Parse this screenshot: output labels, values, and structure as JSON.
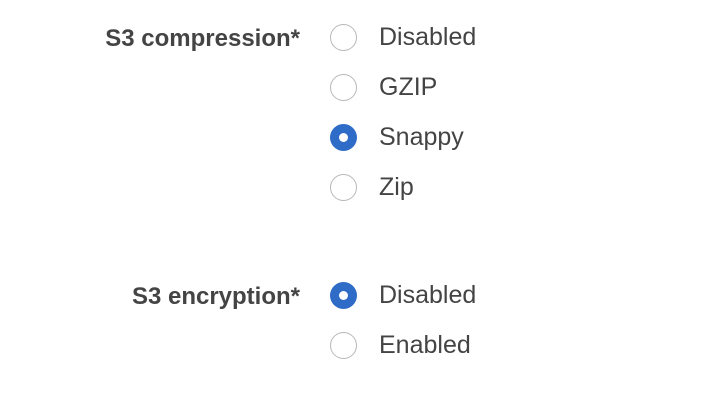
{
  "compression": {
    "label": "S3 compression*",
    "options": [
      {
        "label": "Disabled",
        "selected": false
      },
      {
        "label": "GZIP",
        "selected": false
      },
      {
        "label": "Snappy",
        "selected": true
      },
      {
        "label": "Zip",
        "selected": false
      }
    ]
  },
  "encryption": {
    "label": "S3 encryption*",
    "options": [
      {
        "label": "Disabled",
        "selected": true
      },
      {
        "label": "Enabled",
        "selected": false
      }
    ]
  },
  "colors": {
    "accent": "#2e6cc7",
    "text": "#444444",
    "radio_border": "#b8b8b8"
  }
}
